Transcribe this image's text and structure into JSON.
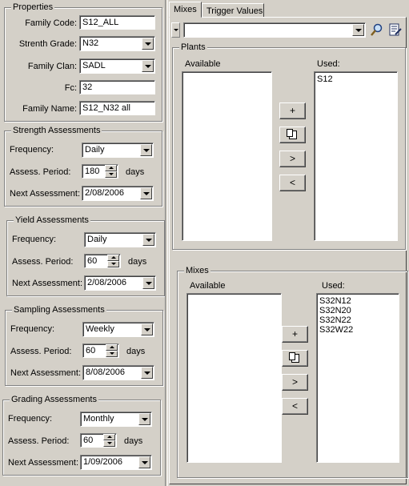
{
  "properties": {
    "title": "Properties",
    "family_code_label": "Family Code:",
    "family_code_value": "S12_ALL",
    "strength_grade_label": "Strenth Grade:",
    "strength_grade_value": "N32",
    "family_clan_label": "Family Clan:",
    "family_clan_value": "SADL",
    "fc_label": "Fc:",
    "fc_value": "32",
    "family_name_label": "Family Name:",
    "family_name_value": "S12_N32 all"
  },
  "assessments": [
    {
      "title": "Strength Assessments",
      "frequency_label": "Frequency:",
      "frequency_value": "Daily",
      "period_label": "Assess. Period:",
      "period_value": "180",
      "period_unit": "days",
      "next_label": "Next Assessment:",
      "next_value": "2/08/2006"
    },
    {
      "title": "Yield Assessments",
      "frequency_label": "Frequency:",
      "frequency_value": "Daily",
      "period_label": "Assess. Period:",
      "period_value": "60",
      "period_unit": "days",
      "next_label": "Next Assessment:",
      "next_value": "2/08/2006"
    },
    {
      "title": "Sampling Assessments",
      "frequency_label": "Frequency:",
      "frequency_value": "Weekly",
      "period_label": "Assess. Period:",
      "period_value": "60",
      "period_unit": "days",
      "next_label": "Next Assessment:",
      "next_value": "8/08/2006"
    },
    {
      "title": "Grading Assessments",
      "frequency_label": "Frequency:",
      "frequency_value": "Monthly",
      "period_label": "Assess. Period:",
      "period_value": "60",
      "period_unit": "days",
      "next_label": "Next Assessment:",
      "next_value": "1/09/2006"
    }
  ],
  "tabs": [
    {
      "label": "Mixes",
      "active": true
    },
    {
      "label": "Trigger Values",
      "active": false
    }
  ],
  "toolbar": {
    "combo_value": "",
    "search_icon": "search-icon",
    "edit_icon": "edit-list-icon"
  },
  "plants": {
    "title": "Plants",
    "available_label": "Available",
    "used_label": "Used:",
    "available_items": [],
    "used_items": [
      "S12"
    ],
    "buttons": [
      "+",
      "copy",
      ">",
      "<"
    ]
  },
  "mixes": {
    "title": "Mixes",
    "available_label": "Available",
    "used_label": "Used:",
    "available_items": [],
    "used_items": [
      "S32N12",
      "S32N20",
      "S32N22",
      "S32W22"
    ],
    "buttons": [
      "+",
      "copy",
      ">",
      "<"
    ]
  },
  "colors": {
    "face": "#d4d0c8",
    "shadow": "#808080",
    "highlight": "#ffffff"
  }
}
